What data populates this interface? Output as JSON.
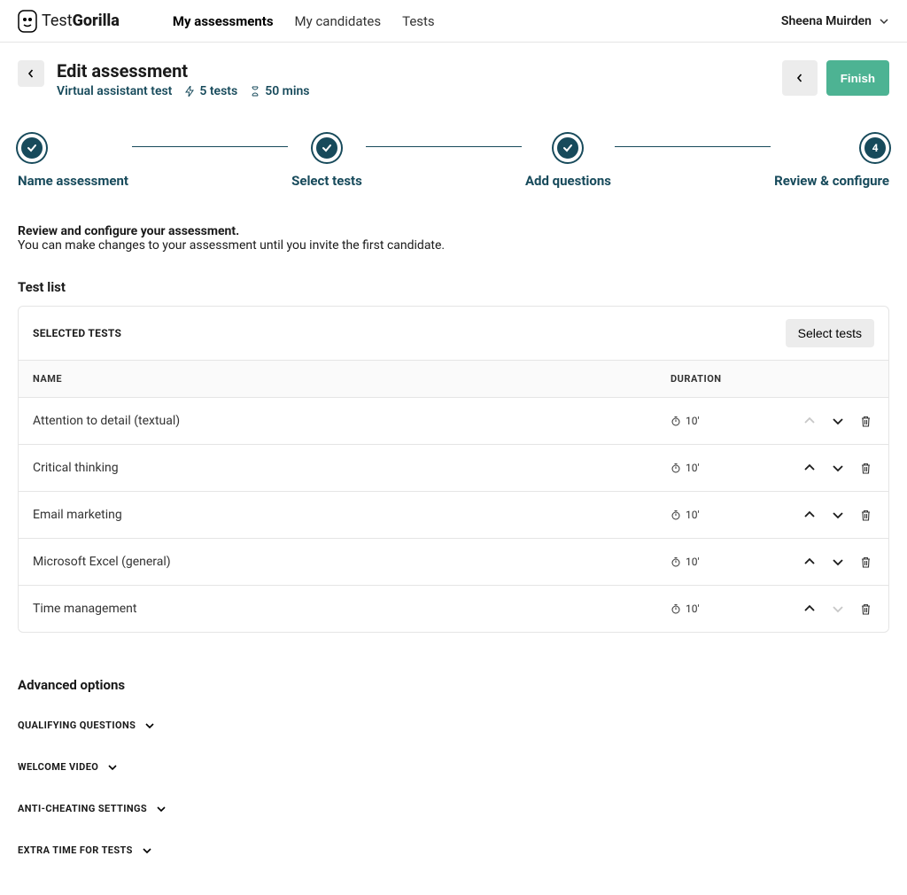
{
  "brand": {
    "prefix": "Test",
    "suffix": "Gorilla"
  },
  "nav": {
    "items": [
      {
        "label": "My assessments",
        "active": true
      },
      {
        "label": "My candidates",
        "active": false
      },
      {
        "label": "Tests",
        "active": false
      }
    ],
    "user_name": "Sheena Muirden"
  },
  "header": {
    "title": "Edit assessment",
    "assessment_name": "Virtual assistant test",
    "tests_count": "5 tests",
    "duration": "50 mins",
    "finish_label": "Finish"
  },
  "steps": [
    {
      "label": "Name assessment",
      "done": true
    },
    {
      "label": "Select tests",
      "done": true
    },
    {
      "label": "Add questions",
      "done": true
    },
    {
      "label": "Review & configure",
      "done": false,
      "num": "4"
    }
  ],
  "intro": {
    "title": "Review and configure your assessment.",
    "sub": "You can make changes to your assessment until you invite the first candidate."
  },
  "test_list": {
    "heading": "Test list",
    "card_title": "SELECTED TESTS",
    "select_tests_label": "Select tests",
    "col_name": "NAME",
    "col_duration": "DURATION",
    "rows": [
      {
        "name": "Attention to detail (textual)",
        "duration": "10'",
        "up_disabled": true,
        "down_disabled": false
      },
      {
        "name": "Critical thinking",
        "duration": "10'",
        "up_disabled": false,
        "down_disabled": false
      },
      {
        "name": "Email marketing",
        "duration": "10'",
        "up_disabled": false,
        "down_disabled": false
      },
      {
        "name": "Microsoft Excel (general)",
        "duration": "10'",
        "up_disabled": false,
        "down_disabled": false
      },
      {
        "name": "Time management",
        "duration": "10'",
        "up_disabled": false,
        "down_disabled": true
      }
    ]
  },
  "advanced": {
    "heading": "Advanced options",
    "items": [
      "QUALIFYING QUESTIONS",
      "WELCOME VIDEO",
      "ANTI-CHEATING SETTINGS",
      "EXTRA TIME FOR TESTS"
    ]
  }
}
